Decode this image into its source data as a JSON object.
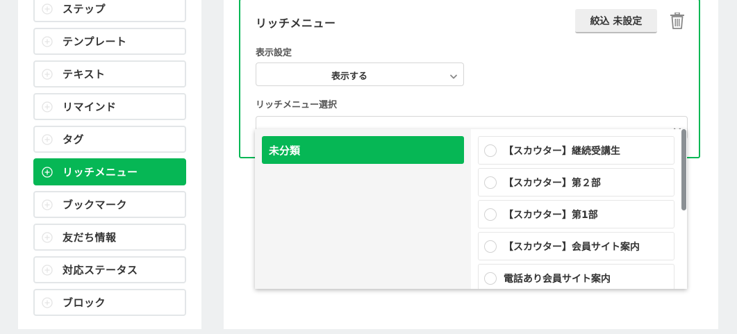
{
  "actions": {
    "items": [
      {
        "label": "ステップ",
        "active": false
      },
      {
        "label": "テンプレート",
        "active": false
      },
      {
        "label": "テキスト",
        "active": false
      },
      {
        "label": "リマインド",
        "active": false
      },
      {
        "label": "タグ",
        "active": false
      },
      {
        "label": "リッチメニュー",
        "active": true
      },
      {
        "label": "ブックマーク",
        "active": false
      },
      {
        "label": "友だち情報",
        "active": false
      },
      {
        "label": "対応ステータス",
        "active": false
      },
      {
        "label": "ブロック",
        "active": false
      }
    ]
  },
  "card": {
    "title": "リッチメニュー",
    "filter_button": "絞込 未設定",
    "display_setting_label": "表示設定",
    "display_setting_value": "表示する",
    "rich_menu_select_label": "リッチメニュー選択",
    "rich_menu_select_value": ""
  },
  "dropdown": {
    "categories": [
      {
        "label": "未分類",
        "selected": true
      }
    ],
    "menus": [
      {
        "label": "【スカウター】継続受講生"
      },
      {
        "label": "【スカウター】第２部"
      },
      {
        "label": "【スカウター】第1部"
      },
      {
        "label": "【スカウター】会員サイト案内"
      },
      {
        "label": "電話あり会員サイト案内"
      }
    ]
  },
  "colors": {
    "accent": "#06b755",
    "background": "#eef0f1",
    "border": "#e3e6e8"
  },
  "icons": {
    "add": "plus-circle-icon",
    "delete": "trash-icon",
    "dropdown": "chevron-down-icon",
    "radio": "radio-icon"
  }
}
